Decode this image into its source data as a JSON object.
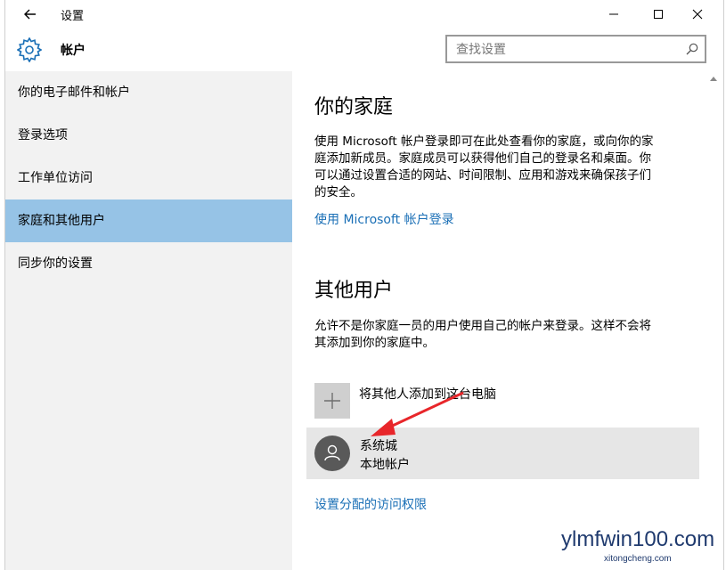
{
  "window": {
    "title": "设置",
    "controls": {
      "minimize": "minimize-icon",
      "maximize": "maximize-icon",
      "close": "close-icon"
    }
  },
  "header": {
    "app_title": "帐户",
    "search_placeholder": "查找设置"
  },
  "sidebar": {
    "items": [
      {
        "label": "你的电子邮件和帐户",
        "selected": false
      },
      {
        "label": "登录选项",
        "selected": false
      },
      {
        "label": "工作单位访问",
        "selected": false
      },
      {
        "label": "家庭和其他用户",
        "selected": true
      },
      {
        "label": "同步你的设置",
        "selected": false
      }
    ]
  },
  "family": {
    "heading": "你的家庭",
    "desc_lines": [
      "使用 Microsoft 帐户登录即可在此处查看你的家庭，或向你的家",
      "庭添加新成员。家庭成员可以获得他们自己的登录名和桌面。你",
      "可以通过设置合适的网站、时间限制、应用和游戏来确保孩子们",
      "的安全。"
    ],
    "signin_link": "使用 Microsoft 帐户登录"
  },
  "others": {
    "heading": "其他用户",
    "desc_lines": [
      "允许不是你家庭一员的用户使用自己的帐户来登录。这样不会将",
      "其添加到你的家庭中。"
    ],
    "add_label": "将其他人添加到这台电脑",
    "user": {
      "name": "系统城",
      "type": "本地帐户"
    },
    "access_link": "设置分配的访问权限"
  },
  "watermark": {
    "main": "ylmfwin100.com",
    "sub": "xitongcheng.com"
  },
  "colors": {
    "selected_bg": "#96c3e6",
    "link": "#1a6fb6",
    "arrow": "#e8262a"
  }
}
